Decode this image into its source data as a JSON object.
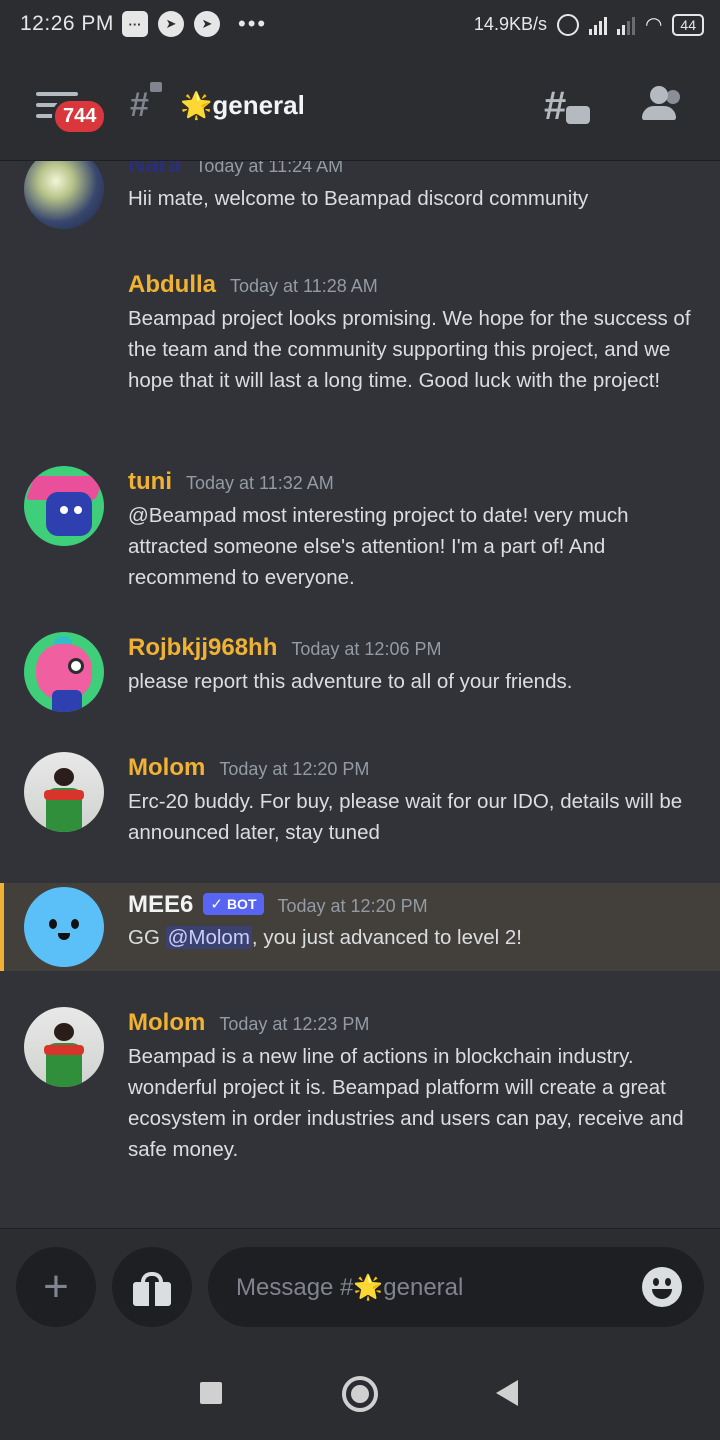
{
  "status_bar": {
    "time": "12:26 PM",
    "net_speed": "14.9KB/s",
    "battery": "44"
  },
  "header": {
    "unread_badge": "744",
    "channel_emoji": "🌟",
    "channel_name": "general"
  },
  "messages": [
    {
      "author": "Nara",
      "timestamp": "Today at 11:24 AM",
      "text": "Hii mate, welcome to Beampad discord community"
    },
    {
      "author": "Abdulla",
      "timestamp": "Today at 11:28 AM",
      "text": "Beampad project looks promising. We hope for the success of the team and the community supporting this project, and we hope that it will last a long time. Good luck with the project!"
    },
    {
      "author": "tuni",
      "timestamp": "Today at 11:32 AM",
      "text": "@Beampad most interesting project to date! very much attracted someone else's attention! I'm a part of! And recommend to everyone."
    },
    {
      "author": "Rojbkjj968hh",
      "timestamp": "Today at 12:06 PM",
      "text": "please report this adventure to all of your friends."
    },
    {
      "author": "Molom",
      "timestamp": "Today at 12:20 PM",
      "text": "Erc-20 buddy. For buy, please wait for our IDO, details will be announced later, stay tuned"
    },
    {
      "author": "MEE6",
      "bot_tag": "BOT",
      "timestamp": "Today at 12:20 PM",
      "text_before": "GG ",
      "mention": "@Molom",
      "text_after": ", you just advanced to level 2!"
    },
    {
      "author": "Molom",
      "timestamp": "Today at 12:23 PM",
      "text": "Beampad is a new line of actions in blockchain industry. wonderful project it is. Beampad platform will create a great ecosystem in order industries and users can pay, receive and safe money."
    }
  ],
  "composer": {
    "placeholder": "Message #🌟general"
  },
  "colors": {
    "background": "#313338",
    "username_gold": "#f0b232",
    "badge_red": "#da373c",
    "bot_blurple": "#5865f2"
  }
}
